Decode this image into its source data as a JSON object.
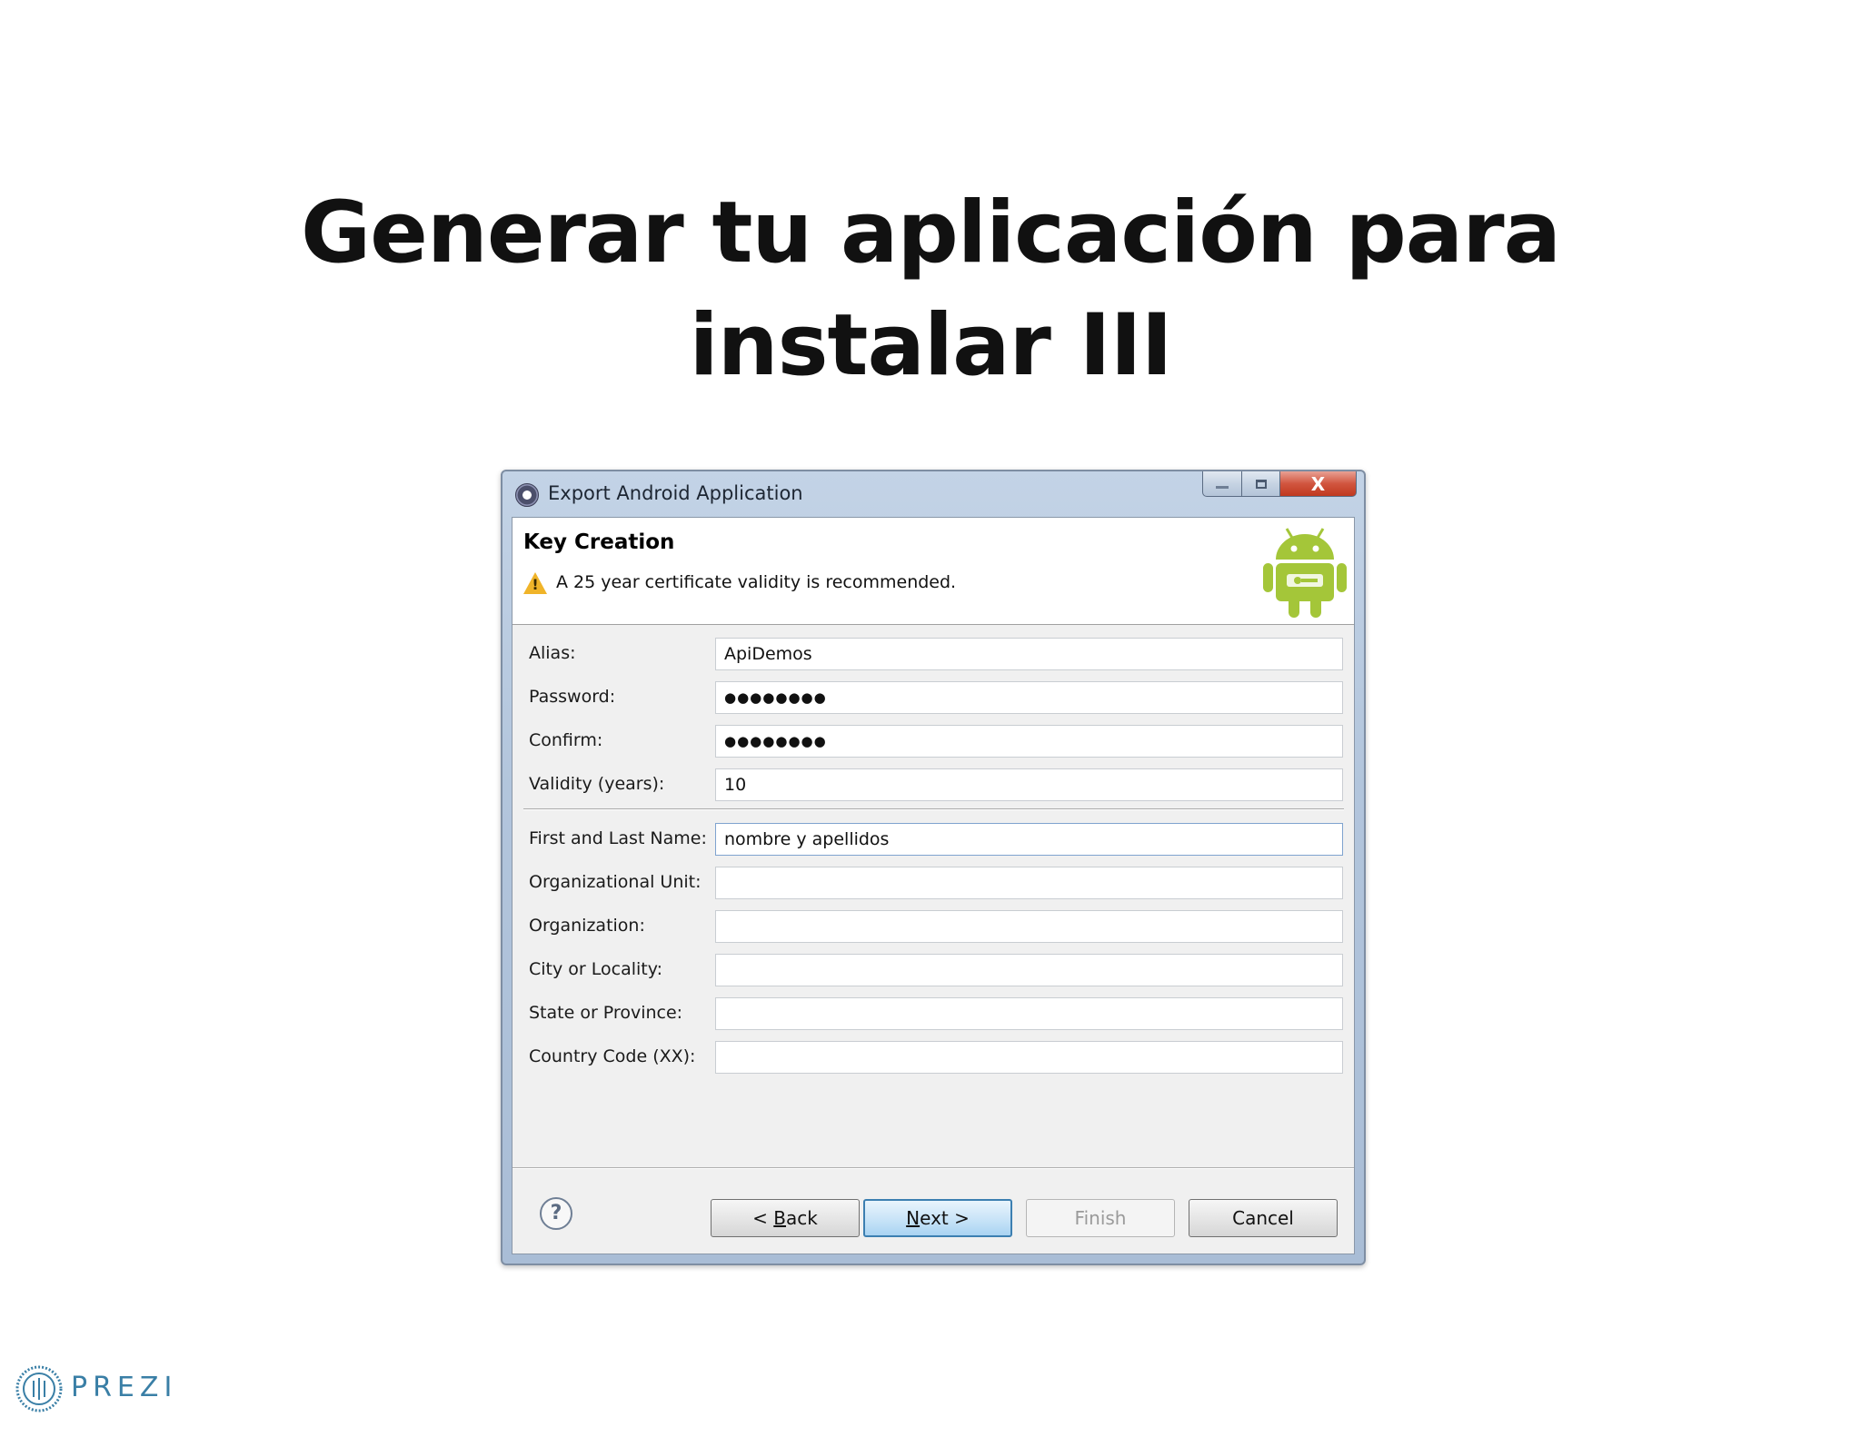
{
  "slide": {
    "title_line1": "Generar tu aplicación para",
    "title_line2": "instalar III"
  },
  "window": {
    "title": "Export Android Application",
    "app_icon": "eclipse-icon",
    "controls": {
      "minimize_icon": "minimize-icon",
      "maximize_icon": "maximize-icon",
      "close_label": "X"
    }
  },
  "header": {
    "heading": "Key Creation",
    "warning_icon": "warning-icon",
    "message": "A 25 year certificate validity is recommended.",
    "logo_icon": "android-icon"
  },
  "form": {
    "fields": [
      {
        "label": "Alias:",
        "value": "ApiDemos",
        "type": "text"
      },
      {
        "label": "Password:",
        "value": "●●●●●●●●",
        "type": "password"
      },
      {
        "label": "Confirm:",
        "value": "●●●●●●●●",
        "type": "password"
      },
      {
        "label": "Validity (years):",
        "value": "10",
        "type": "text"
      },
      {
        "label": "First and Last Name:",
        "value": "nombre y apellidos",
        "type": "text"
      },
      {
        "label": "Organizational Unit:",
        "value": "",
        "type": "text"
      },
      {
        "label": "Organization:",
        "value": "",
        "type": "text"
      },
      {
        "label": "City or Locality:",
        "value": "",
        "type": "text"
      },
      {
        "label": "State or Province:",
        "value": "",
        "type": "text"
      },
      {
        "label": "Country Code (XX):",
        "value": "",
        "type": "text"
      }
    ]
  },
  "footer": {
    "help_icon": "help-icon",
    "help_glyph": "?",
    "back_prefix": "< ",
    "back_mnemonic": "B",
    "back_rest": "ack",
    "next_mnemonic": "N",
    "next_rest": "ext >",
    "finish_label": "Finish",
    "cancel_label": "Cancel"
  },
  "branding": {
    "logo_text": "Prezi",
    "logo_display": "PREZI",
    "logo_icon": "prezi-logo-icon",
    "color": "#3a7fa6"
  },
  "colors": {
    "titlebar": "#b2c5dc",
    "close_button": "#c0391f",
    "next_button_border": "#3c7fb1",
    "warning": "#f0b429",
    "android_green": "#a4c639"
  }
}
